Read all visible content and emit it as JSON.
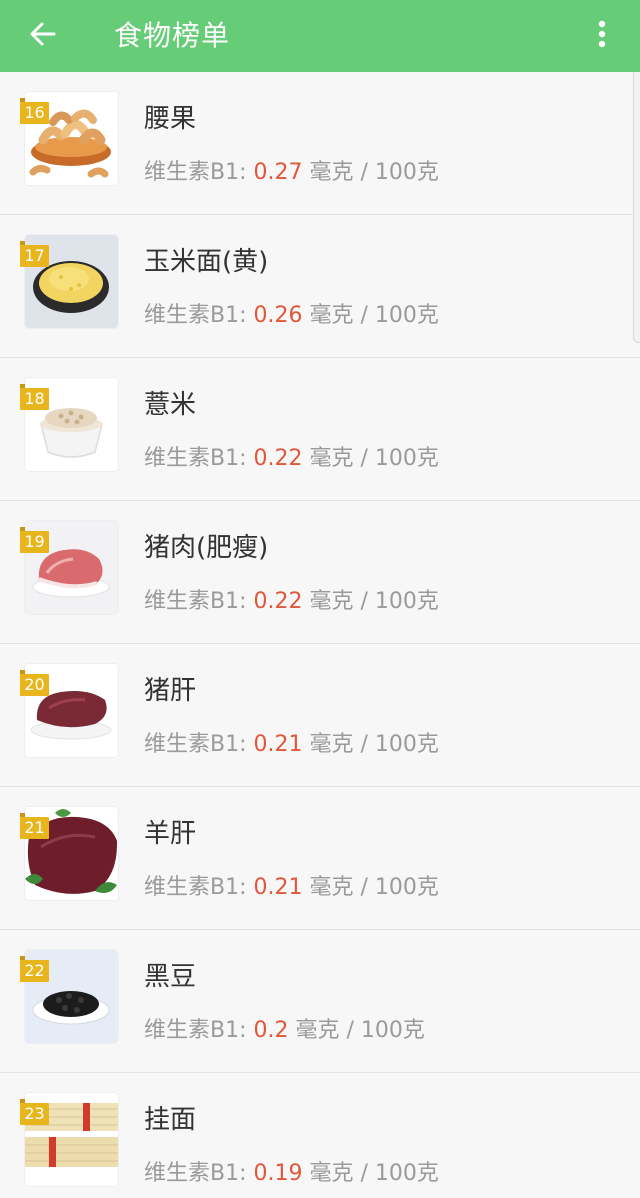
{
  "header": {
    "title": "食物榜单",
    "back_icon": "arrow-left-icon",
    "more_icon": "more-vertical-icon",
    "color": "#66cc77"
  },
  "nutrient_label": "维生素B1:",
  "unit": "毫克 / 100克",
  "value_color": "#e0573a",
  "rank_color": "#e8b51d",
  "items": [
    {
      "rank": "16",
      "name": "腰果",
      "value": "0.27",
      "image": "cashew"
    },
    {
      "rank": "17",
      "name": "玉米面(黄)",
      "value": "0.26",
      "image": "cornmeal"
    },
    {
      "rank": "18",
      "name": "薏米",
      "value": "0.22",
      "image": "barley"
    },
    {
      "rank": "19",
      "name": "猪肉(肥瘦)",
      "value": "0.22",
      "image": "pork"
    },
    {
      "rank": "20",
      "name": "猪肝",
      "value": "0.21",
      "image": "pork-liver"
    },
    {
      "rank": "21",
      "name": "羊肝",
      "value": "0.21",
      "image": "lamb-liver"
    },
    {
      "rank": "22",
      "name": "黑豆",
      "value": "0.2",
      "image": "black-beans"
    },
    {
      "rank": "23",
      "name": "挂面",
      "value": "0.19",
      "image": "noodles"
    }
  ]
}
